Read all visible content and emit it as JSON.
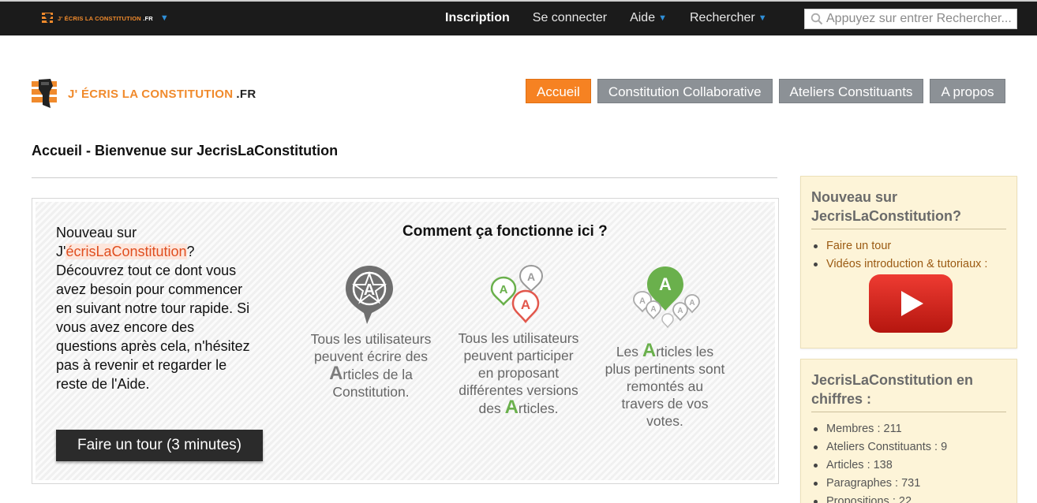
{
  "topbar": {
    "logo_text": "J' ÉCRIS LA CONSTITUTION",
    "logo_tld": ".FR",
    "nav": [
      {
        "label": "Inscription",
        "bold": true,
        "dropdown": false
      },
      {
        "label": "Se connecter",
        "bold": false,
        "dropdown": false
      },
      {
        "label": "Aide",
        "bold": false,
        "dropdown": true
      },
      {
        "label": "Rechercher",
        "bold": false,
        "dropdown": true
      }
    ],
    "search_placeholder": "Appuyez sur entrer Rechercher..."
  },
  "header": {
    "logo_text": "J' ÉCRIS LA CONSTITUTION",
    "logo_tld": ".FR"
  },
  "main_nav": [
    {
      "label": "Accueil",
      "active": true
    },
    {
      "label": "Constitution Collaborative",
      "active": false
    },
    {
      "label": "Ateliers Constituants",
      "active": false
    },
    {
      "label": "A propos",
      "active": false
    }
  ],
  "page_title": "Accueil - Bienvenue sur JecrisLaConstitution",
  "tour": {
    "intro_line1": "Nouveau sur",
    "intro_brand_prefix": "J'",
    "intro_brand_accent": "écrisLaConstitution",
    "intro_brand_suffix": "?",
    "intro_body": "Découvrez tout ce dont vous avez besoin pour commencer en suivant notre tour rapide. Si vous avez encore des questions après cela, n'hésitez pas à revenir et regarder le reste de l'Aide.",
    "button_label": "Faire un tour (3 minutes)",
    "how_title": "Comment ça fonctionne ici ?",
    "features": [
      {
        "before": "Tous les utilisateurs peuvent écrire des ",
        "A": "A",
        "after": "rticles de la Constitution."
      },
      {
        "before": "Tous les utilisateurs peuvent participer en proposant différentes versions des ",
        "A": "A",
        "after": "rticles."
      },
      {
        "before": "Les ",
        "A": "A",
        "after": "rticles les plus pertinents sont remontés au travers de vos votes."
      }
    ]
  },
  "sidebar": {
    "box1": {
      "title": "Nouveau sur JecrisLaConstitution?",
      "items": [
        "Faire un tour",
        "Vidéos introduction & tutoriaux :"
      ]
    },
    "box2": {
      "title": "JecrisLaConstitution en chiffres :",
      "items": [
        "Membres : 211",
        "Ateliers Constituants : 9",
        "Articles : 138",
        "Paragraphes : 731",
        "Propositions : 22"
      ]
    }
  },
  "colors": {
    "accent_orange": "#f68222",
    "nav_gray": "#8c9196",
    "topbar_bg": "#1b1b1b",
    "sidebar_bg": "#fdf4d8",
    "pin_green": "#6ab04c",
    "pin_red": "#e2574c",
    "youtube_red": "#d5211b"
  },
  "icons": [
    "fist-logo-icon",
    "dropdown-caret-icon",
    "search-icon",
    "anarchy-a-pin-icon",
    "multi-pins-icon",
    "top-pin-icon",
    "youtube-play-icon"
  ]
}
